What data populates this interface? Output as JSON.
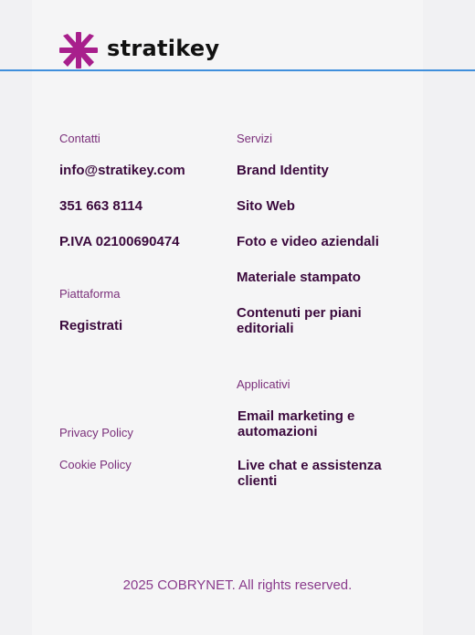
{
  "brand": {
    "name": "stratikey",
    "accent": "#a81f8c",
    "text_color": "#3b0a3d"
  },
  "contacts": {
    "title": "Contatti",
    "email": "info@stratikey.com",
    "phone": "351 663 8114",
    "vat": "P.IVA 02100690474"
  },
  "platform": {
    "title": "Piattaforma",
    "register": "Registrati"
  },
  "legal": {
    "privacy": "Privacy Policy",
    "cookie": "Cookie Policy"
  },
  "services": {
    "title": "Servizi",
    "items": [
      "Brand Identity",
      "Sito Web",
      "Foto e video aziendali",
      "Materiale stampato",
      "Contenuti per piani editoriali"
    ]
  },
  "apps": {
    "title": "Applicativi",
    "items": [
      "Email marketing e automazioni",
      "Live chat e assistenza clienti"
    ]
  },
  "footer": {
    "copyright": "2025 COBRYNET. All rights reserved."
  }
}
